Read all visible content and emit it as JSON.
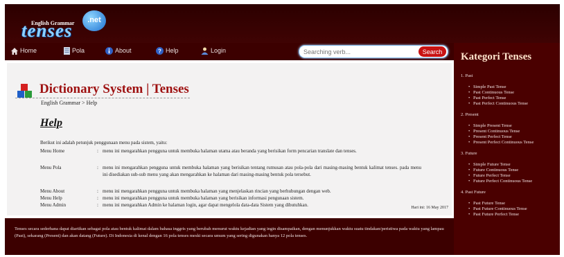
{
  "logo": {
    "small_text": "English Grammar",
    "big_text": "tenses",
    "badge": ".net"
  },
  "nav": [
    {
      "label": "Home",
      "icon": "home-icon"
    },
    {
      "label": "Pola",
      "icon": "document-icon"
    },
    {
      "label": "About",
      "icon": "info-icon"
    },
    {
      "label": "Help",
      "icon": "help-icon"
    },
    {
      "label": "Login",
      "icon": "user-icon"
    }
  ],
  "search": {
    "placeholder": "Searching verb...",
    "button_label": "Search"
  },
  "page": {
    "title": "Dictionary System | Tenses",
    "breadcrumb": "English Grammar > Help",
    "heading": "Help",
    "intro": "Berikut ini adalah petunjuk penggunaan menu pada sistem, yaitu:",
    "menus": [
      {
        "name": "Menu Home",
        "desc": "menu ini mengarahkan pengguna untuk membuka halaman utama atau beranda yang berisikan form pencarian translate dan tenses."
      },
      {
        "name": "Menu Pola",
        "desc": "menu ini mengarahkan pengguna untuk membuka halaman yang berisikan tentang rumusan atau pola-pola dari masing-masing bentuk kalimat tenses. pada menu ini disediakan sub-sub menu yang akan mengarahkan ke halaman dari masing-masing bentuk pola tersebut."
      },
      {
        "name": "Menu About",
        "desc": "menu ini mengarahkan pengguna untuk membuka halaman yang menjelaskan rincian yang berhubungan dengan web."
      },
      {
        "name": "Menu Help",
        "desc": "menu ini mengarahkan pengguna untuk membuka halaman yang berisikan informasi pengunaan sistem."
      },
      {
        "name": "Menu Admin",
        "desc": "menu ini mengarahkan Admin ke halaman login, agar dapat mengelola data-data Sistem yang dibutuhkan."
      }
    ],
    "date": "Hari ini: 16 May 2017"
  },
  "footer": {
    "text": "Tenses secara sederhana dapat diartikan sebagai pola atau bentuk kalimat dalam bahasa inggris yang berubah menurut waktu kejadian yang ingin disampaikan, dengan menunjukkan waktu suatu tindakan/peristiwa pada waktu yang lampau (Past), sekarang (Present) dan akan datang (Future). Di Indonesia di kenal dengan 16 pola tenses meski secara umum yang sering digunakan hanya 12 pola tenses."
  },
  "sidebar": {
    "title": "Kategori Tenses",
    "groups": [
      {
        "label": "1. Past",
        "items": [
          "Simple Past Tense",
          "Past Continuous Tense",
          "Past Perfect Tense",
          "Past Perfect Continuous Tense"
        ]
      },
      {
        "label": "2. Present",
        "items": [
          "Simple Present Tense",
          "Present Continuous Tense",
          "Present Perfect Tense",
          "Present Perfect Continuous Tense"
        ]
      },
      {
        "label": "3. Future",
        "items": [
          "Simple Future Tense",
          "Future Continuous Tense",
          "Future Perfect Tense",
          "Future Perfect Continuous Tense"
        ]
      },
      {
        "label": "4. Past Future",
        "items": [
          "Past Future Tense",
          "Past Future Continuous Tense",
          "Past Future Perfect Tense"
        ]
      }
    ]
  },
  "colors": {
    "accent": "#9e1111",
    "background": "#3a0000",
    "search_button": "#c81313"
  }
}
